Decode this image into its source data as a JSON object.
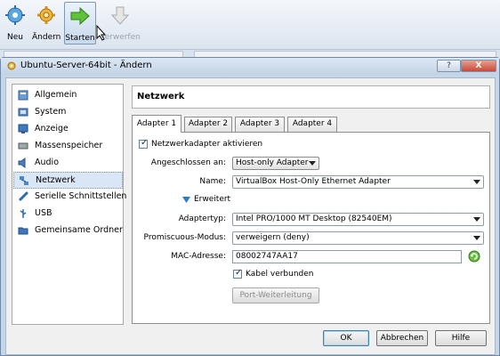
{
  "toolbar": {
    "new_label": "Neu",
    "change_label": "Ändern",
    "start_label": "Starten",
    "discard_label": "Verwerfen"
  },
  "dialog": {
    "title": "Ubuntu-Server-64bit - Ändern",
    "help_button": "?",
    "close_button": "X"
  },
  "nav": {
    "items": [
      {
        "label": "Allgemein",
        "icon": "general-icon"
      },
      {
        "label": "System",
        "icon": "system-icon"
      },
      {
        "label": "Anzeige",
        "icon": "display-icon"
      },
      {
        "label": "Massenspeicher",
        "icon": "storage-icon"
      },
      {
        "label": "Audio",
        "icon": "audio-icon"
      },
      {
        "label": "Netzwerk",
        "icon": "network-icon"
      },
      {
        "label": "Serielle Schnittstellen",
        "icon": "serial-icon"
      },
      {
        "label": "USB",
        "icon": "usb-icon"
      },
      {
        "label": "Gemeinsame Ordner",
        "icon": "shared-folder-icon"
      }
    ],
    "selected": "Netzwerk"
  },
  "page": {
    "title": "Netzwerk"
  },
  "tabs": [
    {
      "label": "Adapter 1",
      "active": true
    },
    {
      "label": "Adapter 2",
      "active": false
    },
    {
      "label": "Adapter 3",
      "active": false
    },
    {
      "label": "Adapter 4",
      "active": false
    }
  ],
  "adapter": {
    "enable_label": "Netzwerkadapter aktivieren",
    "enable_checked": true,
    "attached_label": "Angeschlossen an:",
    "attached_value": "Host-only Adapter",
    "name_label": "Name:",
    "name_value": "VirtualBox Host-Only Ethernet Adapter",
    "advanced_label": "Erweitert",
    "adapter_type_label": "Adaptertyp:",
    "adapter_type_value": "Intel PRO/1000 MT Desktop (82540EM)",
    "promisc_label": "Promiscuous-Modus:",
    "promisc_value": "verweigern (deny)",
    "mac_label": "MAC-Adresse:",
    "mac_value": "08002747AA17",
    "cable_label": "Kabel verbunden",
    "cable_checked": true,
    "port_forwarding_label": "Port-Weiterleitung"
  },
  "footer": {
    "ok_label": "OK",
    "cancel_label": "Abbrechen",
    "help_label": "Hilfe"
  }
}
